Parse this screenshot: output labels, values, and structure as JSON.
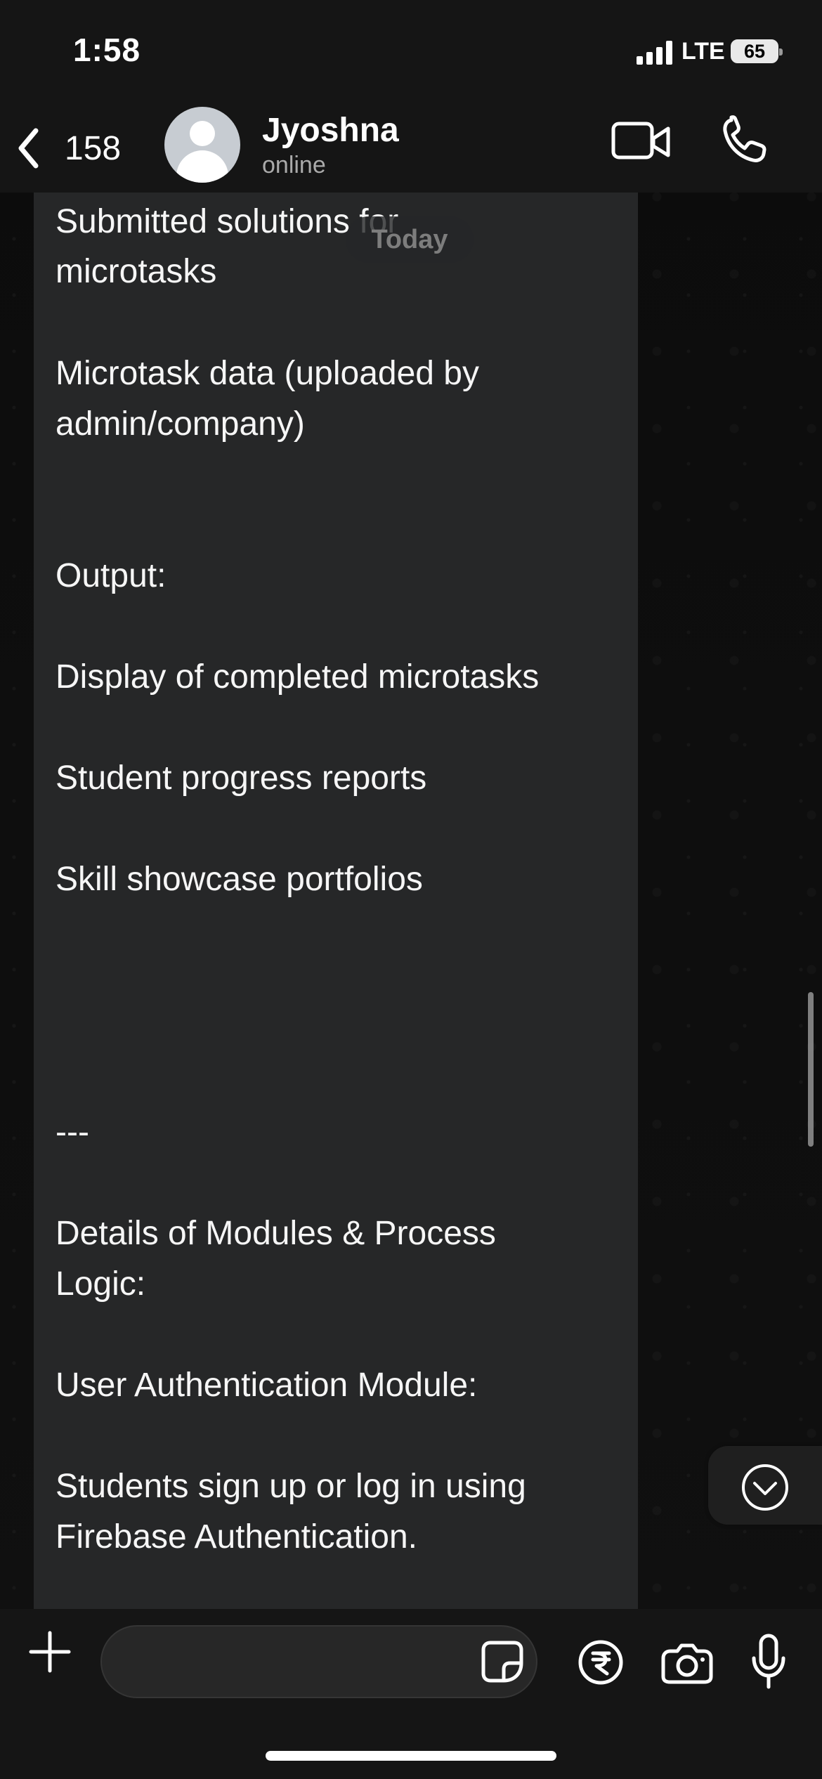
{
  "status_bar": {
    "time": "1:58",
    "network": "LTE",
    "battery": "65"
  },
  "chat_header": {
    "back_count": "158",
    "contact_name": "Jyoshna",
    "contact_status": "online",
    "icons": {
      "back": "chevron-left-icon",
      "video": "video-camera-icon",
      "phone": "phone-icon"
    }
  },
  "message": {
    "date_chip": "Today",
    "lines": [
      "Submitted solutions for",
      "microtasks",
      "Microtask data (uploaded by",
      "admin/company)",
      "Output:",
      "Display of completed microtasks",
      "Student progress reports",
      "Skill showcase portfolios",
      "---",
      "Details of Modules & Process",
      "Logic:",
      "User Authentication Module:",
      "Students sign up or log in using",
      "Firebase Authentication."
    ]
  },
  "composer": {
    "input_value": "",
    "input_placeholder": "",
    "icons": {
      "add": "plus-icon",
      "sticker": "sticker-icon",
      "payment": "rupee-icon",
      "camera": "camera-icon",
      "mic": "microphone-icon",
      "scroll_down": "chevron-down-circle-icon"
    }
  },
  "colors": {
    "header_background": "#151515",
    "bubble_background": "#262728",
    "screen_background": "#0b0b0b",
    "text": "#ffffff",
    "muted_text": "#aaaaaa"
  }
}
